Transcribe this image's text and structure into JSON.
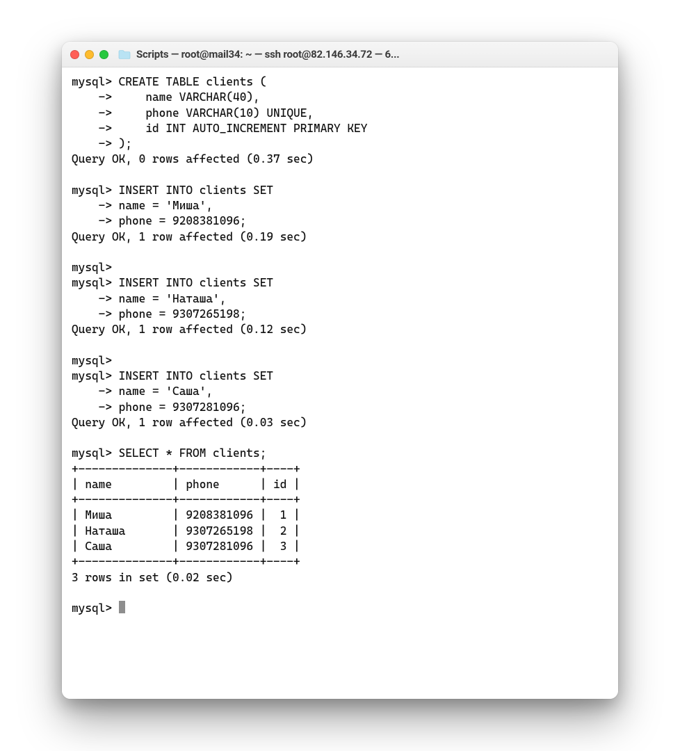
{
  "window": {
    "title": "Scripts — root@mail34: ~ — ssh root@82.146.34.72 — 6...",
    "traffic_lights": {
      "close": "#ff5f57",
      "min": "#febc2e",
      "max": "#28c840"
    },
    "folder_icon_name": "folder-icon"
  },
  "terminal": {
    "lines": [
      "mysql> CREATE TABLE clients (",
      "    ->     name VARCHAR(40),",
      "    ->     phone VARCHAR(10) UNIQUE,",
      "    ->     id INT AUTO_INCREMENT PRIMARY KEY",
      "    -> );",
      "Query OK, 0 rows affected (0.37 sec)",
      "",
      "mysql> INSERT INTO clients SET",
      "    -> name = 'Миша',",
      "    -> phone = 9208381096;",
      "Query OK, 1 row affected (0.19 sec)",
      "",
      "mysql>",
      "mysql> INSERT INTO clients SET",
      "    -> name = 'Наташа',",
      "    -> phone = 9307265198;",
      "Query OK, 1 row affected (0.12 sec)",
      "",
      "mysql>",
      "mysql> INSERT INTO clients SET",
      "    -> name = 'Саша',",
      "    -> phone = 9307281096;",
      "Query OK, 1 row affected (0.03 sec)",
      "",
      "mysql> SELECT * FROM clients;",
      "+--------------+------------+----+",
      "| name         | phone      | id |",
      "+--------------+------------+----+",
      "| Миша         | 9208381096 |  1 |",
      "| Наташа       | 9307265198 |  2 |",
      "| Саша         | 9307281096 |  3 |",
      "+--------------+------------+----+",
      "3 rows in set (0.02 sec)",
      "",
      "mysql> "
    ],
    "prompt_cursor": true
  }
}
